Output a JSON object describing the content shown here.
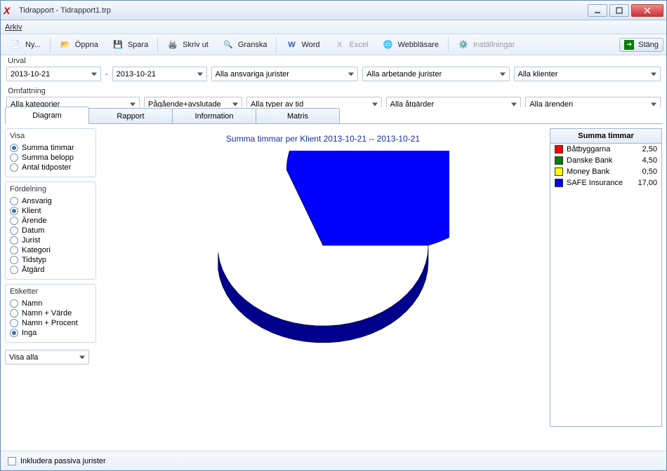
{
  "window": {
    "title": "Tidrapport - Tidrapport1.trp"
  },
  "menu": {
    "arkiv": "Arkiv"
  },
  "toolbar": {
    "ny": "Ny...",
    "oppna": "Öppna",
    "spara": "Spara",
    "skrivut": "Skriv ut",
    "granska": "Granska",
    "word": "Word",
    "excel": "Excel",
    "webb": "Webbläsare",
    "install": "Inställningar",
    "stang": "Stäng"
  },
  "urval": {
    "label": "Urval",
    "date_from": "2013-10-21",
    "date_to": "2013-10-21",
    "ansvariga": "Alla ansvariga jurister",
    "arbetande": "Alla arbetande jurister",
    "klienter": "Alla klienter"
  },
  "omfattning": {
    "label": "Omfattning",
    "kategorier": "Alla kategorier",
    "pagaende": "Pågående+avslutade",
    "tidtyper": "Alla typer av tid",
    "atgarder": "Alla åtgärder",
    "arenden": "Alla ärenden"
  },
  "tabs": {
    "diagram": "Diagram",
    "rapport": "Rapport",
    "information": "Information",
    "matris": "Matris"
  },
  "visa": {
    "label": "Visa",
    "summa_timmar": "Summa timmar",
    "summa_belopp": "Summa belopp",
    "antal_tidposter": "Antal tidposter"
  },
  "fordelning": {
    "label": "Fördelning",
    "ansvarig": "Ansvarig",
    "klient": "Klient",
    "arende": "Ärende",
    "datum": "Datum",
    "jurist": "Jurist",
    "kategori": "Kategori",
    "tidstyp": "Tidstyp",
    "atgard": "Åtgärd"
  },
  "etiketter": {
    "label": "Etiketter",
    "namn": "Namn",
    "namn_varde": "Namn + Värde",
    "namn_procent": "Namn + Procent",
    "inga": "Inga"
  },
  "visa_alla": "Visa alla",
  "chart": {
    "title": "Summa timmar per Klient  2013-10-21 -- 2013-10-21"
  },
  "legend": {
    "header": "Summa timmar",
    "rows": [
      {
        "label": "Båtbyggarna",
        "value": "2,50",
        "color": "#ff0000"
      },
      {
        "label": "Danske Bank",
        "value": "4,50",
        "color": "#008000"
      },
      {
        "label": "Money Bank",
        "value": "0,50",
        "color": "#ffff00"
      },
      {
        "label": "SAFE Insurance",
        "value": "17,00",
        "color": "#0000ff"
      }
    ]
  },
  "footer": {
    "inkludera": "Inkludera passiva jurister"
  },
  "chart_data": {
    "type": "pie",
    "title": "Summa timmar per Klient  2013-10-21 -- 2013-10-21",
    "series": [
      {
        "name": "Båtbyggarna",
        "value": 2.5,
        "color": "#ff0000"
      },
      {
        "name": "Danske Bank",
        "value": 4.5,
        "color": "#008000"
      },
      {
        "name": "Money Bank",
        "value": 0.5,
        "color": "#ffff00"
      },
      {
        "name": "SAFE Insurance",
        "value": 17.0,
        "color": "#0000ff"
      }
    ]
  }
}
